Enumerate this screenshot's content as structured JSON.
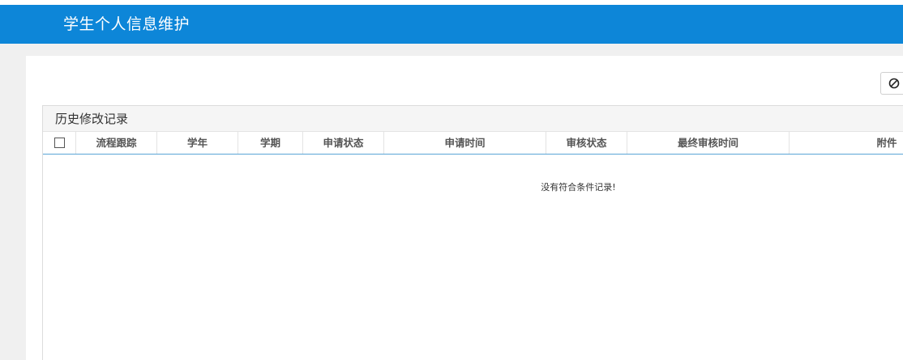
{
  "header": {
    "title": "学生个人信息维护"
  },
  "history": {
    "title": "历史修改记录",
    "columns": [
      "流程跟踪",
      "学年",
      "学期",
      "申请状态",
      "申请时间",
      "审核状态",
      "最终审核时间",
      "附件"
    ],
    "empty_message": "没有符合条件记录!"
  },
  "colors": {
    "header_bg": "#0d86d8",
    "accent_tab": "#5b3f8f"
  },
  "icons": {
    "action": "ban-icon"
  }
}
